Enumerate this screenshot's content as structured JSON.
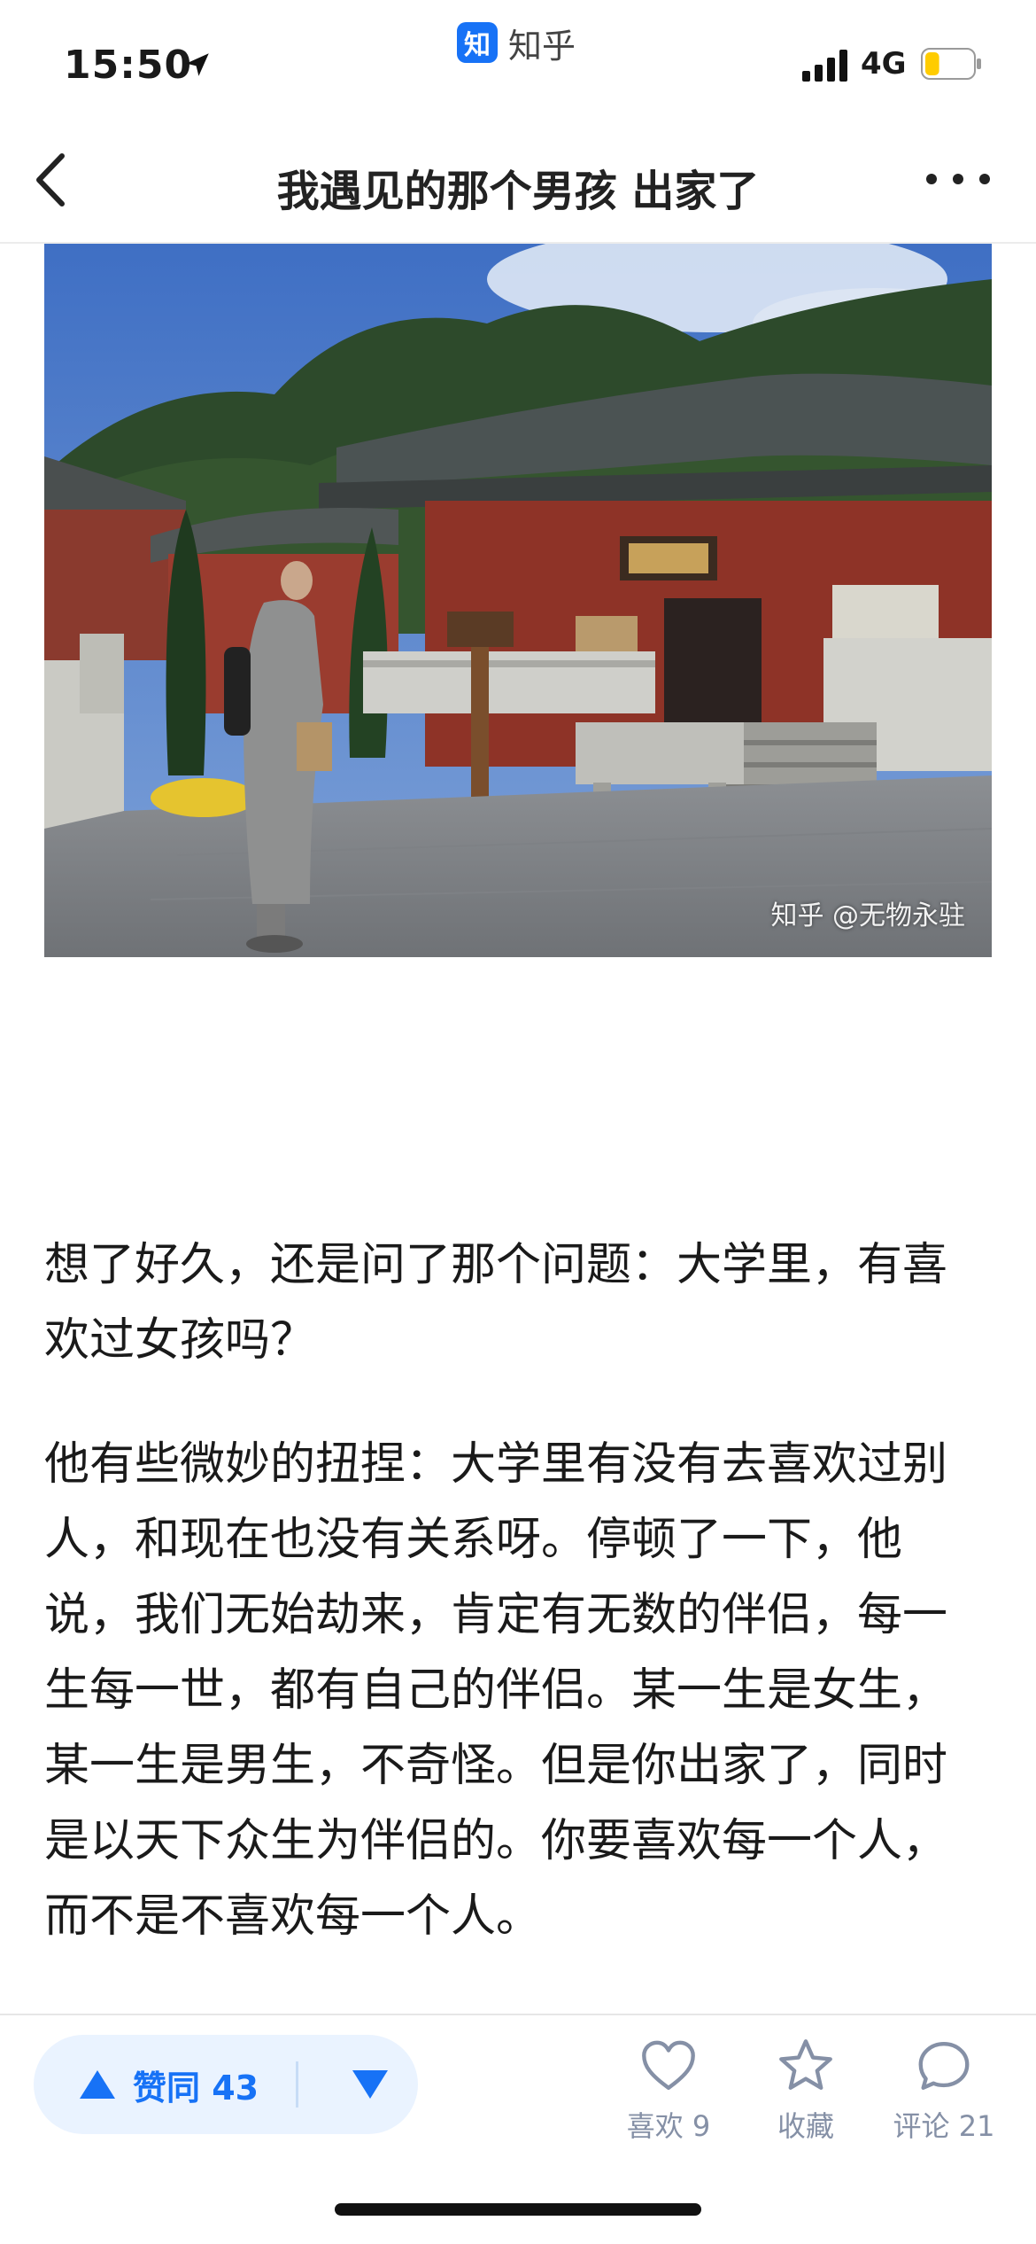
{
  "status_bar": {
    "time": "15:50",
    "app_name": "知乎",
    "app_logo_text": "知",
    "network": "4G",
    "battery_level": 0.3,
    "battery_color": "#ffcc00"
  },
  "nav": {
    "title": "我遇见的那个男孩 出家了"
  },
  "photo": {
    "watermark": "知乎 @无物永驻"
  },
  "article": {
    "paragraphs": [
      "想了好久，还是问了那个问题：大学里，有喜欢过女孩吗？",
      "他有些微妙的扭捏：大学里有没有去喜欢过别人，和现在也没有关系呀。停顿了一下，他说，我们无始劫来，肯定有无数的伴侣，每一生每一世，都有自己的伴侣。某一生是女生，某一生是男生，不奇怪。但是你出家了，同时是以天下众生为伴侣的。你要喜欢每一个人，而不是不喜欢每一个人。"
    ]
  },
  "bottom_bar": {
    "upvote_label": "赞同 43",
    "like_label": "喜欢 9",
    "collect_label": "收藏",
    "comment_label": "评论 21"
  },
  "colors": {
    "accent": "#1772f6",
    "vote_bg": "#eaf3ff",
    "muted": "#8590a6"
  }
}
